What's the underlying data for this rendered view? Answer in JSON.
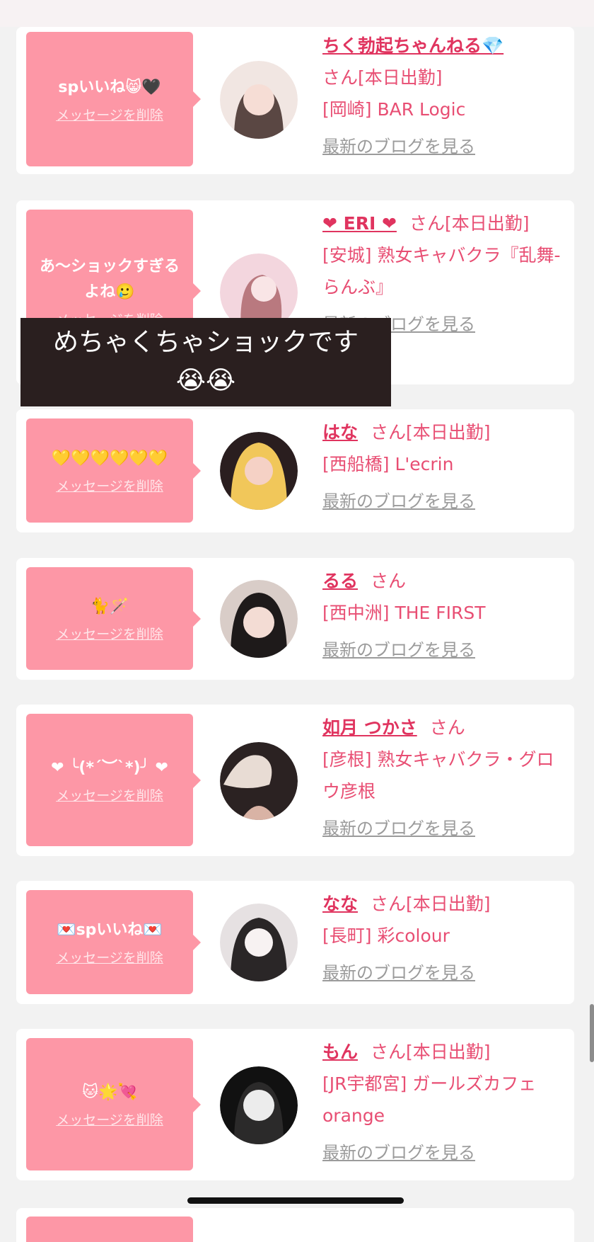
{
  "items": [
    {
      "message": "spいいね😸🖤",
      "delete_label": "メッセージを削除",
      "name": "ちく勃起ちゃんねる💎",
      "san": "さん[本日出勤]",
      "shop": "[岡崎] BAR Logic",
      "blog": "最新のブログを見る",
      "avatar_colors": [
        "#f1e6e2",
        "#5a4743"
      ]
    },
    {
      "message": "あ～ショックすぎるよね🥲",
      "delete_label": "メッセージを削除",
      "name": "❤ ERI ❤",
      "san": "さん[本日出勤]",
      "shop": "[安城] 熟女キャバクラ『乱舞-らんぶ』",
      "blog": "最新のブログを見る",
      "avatar_colors": [
        "#f3d6de",
        "#b9797f"
      ]
    },
    {
      "message": "💛💛💛💛💛💛",
      "delete_label": "メッセージを削除",
      "name": "はな",
      "san": "さん[本日出勤]",
      "shop": "[西船橋] L'ecrin",
      "blog": "最新のブログを見る",
      "avatar_colors": [
        "#f1c75a",
        "#2a1e1f"
      ]
    },
    {
      "message": "🐈🪄",
      "delete_label": "メッセージを削除",
      "name": "るる",
      "san": "さん",
      "shop": "[西中洲] THE FIRST",
      "blog": "最新のブログを見る",
      "avatar_colors": [
        "#d9cdc8",
        "#1e1a1a"
      ]
    },
    {
      "message": "❤ ╰(*´︶`*)╯ ❤",
      "delete_label": "メッセージを削除",
      "name": "如月 つかさ",
      "san": "さん",
      "shop": "[彦根] 熟女キャバクラ・グロウ彦根",
      "blog": "最新のブログを見る",
      "avatar_colors": [
        "#e8dcd4",
        "#2b2222"
      ]
    },
    {
      "message": "💌spいいね💌",
      "delete_label": "メッセージを削除",
      "name": "なな",
      "san": "さん[本日出勤]",
      "shop": "[長町] 彩colour",
      "blog": "最新のブログを見る",
      "avatar_colors": [
        "#e6e1e2",
        "#2a2627"
      ]
    },
    {
      "message": "🐱🌟💘",
      "delete_label": "メッセージを削除",
      "name": "もん",
      "san": "さん[本日出勤]",
      "shop": "[JR宇都宮] ガールズカフェ orange",
      "blog": "最新のブログを見る",
      "avatar_colors": [
        "#ececec",
        "#111111"
      ]
    }
  ],
  "overlay": {
    "line1": "めちゃくちゃショックです",
    "line2": "😭😭"
  },
  "colors": {
    "bubble": "#fd97a6",
    "name": "#e0345f",
    "text": "#e84e73",
    "blog_link": "#9b9b9b"
  }
}
